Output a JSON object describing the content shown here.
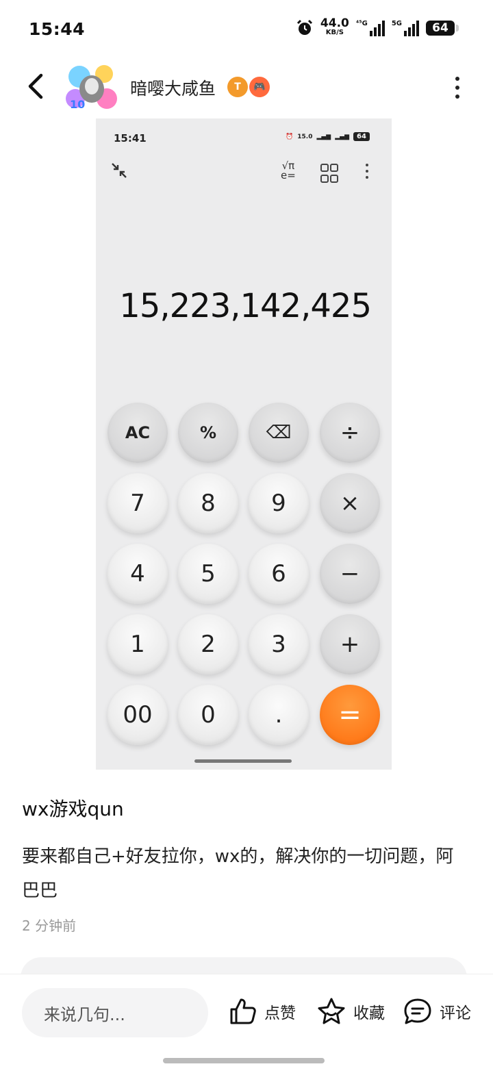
{
  "status_bar": {
    "time": "15:44",
    "net_speed": "44.0",
    "net_unit": "KB/S",
    "sig1_label": "⁴⁵G",
    "sig2_label": "5G",
    "battery": "64"
  },
  "header": {
    "user_name": "暗嘤大咸鱼",
    "badge1": "T",
    "badge2": "🎮"
  },
  "calculator": {
    "time": "15:41",
    "net_speed": "15.0",
    "battery": "64",
    "sci_top": "√π",
    "sci_bottom": "e=",
    "display": "15,223,142,425",
    "keys": [
      "AC",
      "%",
      "⌫",
      "÷",
      "7",
      "8",
      "9",
      "×",
      "4",
      "5",
      "6",
      "−",
      "1",
      "2",
      "3",
      "+",
      "00",
      "0",
      ".",
      "="
    ]
  },
  "post": {
    "title": "wx游戏qun",
    "body": "要来都自己+好友拉你，wx的，解决你的一切问题，阿巴巴",
    "time": "2 分钟前"
  },
  "bottom_bar": {
    "comment_placeholder": "来说几句...",
    "like_label": "点赞",
    "fav_label": "收藏",
    "comment_label": "评论"
  },
  "colors": {
    "accent": "#ff7a1a",
    "calc_bg": "#ececed"
  }
}
